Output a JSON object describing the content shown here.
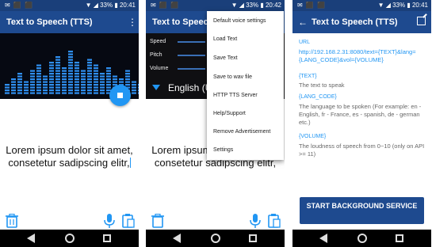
{
  "panel1": {
    "status": {
      "left": "✉ ⬛ ⬛",
      "right": "▼ ◢ 33% ▮ 20:41"
    },
    "title": "Text to Speech (TTS)",
    "text_line1": "Lorem ipsum dolor sit amet,",
    "text_line2": "consetetur sadipscing elitr,"
  },
  "panel2": {
    "status": {
      "left": "✉ ⬛ ⬛",
      "right": "▼ ◢ 33% ▮ 20:42"
    },
    "title": "Text to Speech (",
    "sliders": {
      "speed": "Speed",
      "pitch": "Pitch",
      "volume": "Volume"
    },
    "language": "English (U",
    "text_line1": "Lorem ipsum dolor sit amet,",
    "text_line2": "consetetur sadipscing elitr,",
    "menu": [
      "Default voice settings",
      "Load Text",
      "Save Text",
      "Save to wav file",
      "HTTP TTS Server",
      "Help/Support",
      "Remove Advertisement",
      "Settings"
    ]
  },
  "panel3": {
    "status": {
      "left": "✉ ⬛ ⬛",
      "right": "▼ ◢ 33% ▮ 20:41"
    },
    "title": "Text to Speech (TTS)",
    "url_label": "URL",
    "url_value": "http://192.168.2.31:8080/text={TEXT}&lang={LANG_CODE}&vol={VOLUME}",
    "text_label": "{TEXT}",
    "text_desc": "The text to speak",
    "lang_label": "{LANG_CODE}",
    "lang_desc": "The language to be spoken (For example: en - English, fr - France, es - spanish, de - german etc.)",
    "vol_label": "{VOLUME}",
    "vol_desc": "The loudness of speech from 0~10 (only on API >= 11)",
    "start_button": "START BACKGROUND SERVICE"
  },
  "colors": {
    "appbar": "#1e4a8f",
    "statusbar": "#1a3f7a",
    "accent": "#2196f3",
    "viz_bar": "#2f8ff0"
  }
}
